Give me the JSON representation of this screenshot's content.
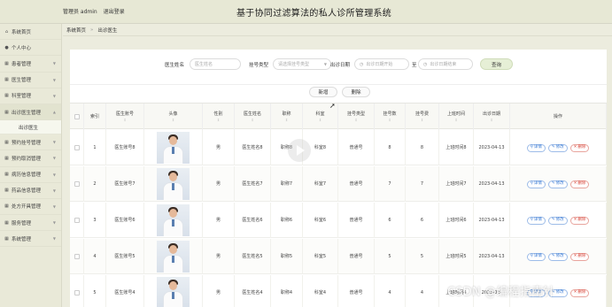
{
  "header": {
    "admin_label": "管理员 admin",
    "logout_label": "退出登录",
    "title": "基于协同过滤算法的私人诊所管理系统"
  },
  "sidebar": {
    "items": [
      {
        "label": "系统首页",
        "icon": "home-icon"
      },
      {
        "label": "个人中心",
        "icon": "user-icon"
      },
      {
        "label": "患者管理",
        "icon": "grid-icon"
      },
      {
        "label": "医生管理",
        "icon": "grid-icon"
      },
      {
        "label": "科室管理",
        "icon": "grid-icon"
      },
      {
        "label": "出诊医生管理",
        "icon": "grid-icon"
      },
      {
        "label": "出诊医生",
        "icon": ""
      },
      {
        "label": "预约挂号管理",
        "icon": "grid-icon"
      },
      {
        "label": "预约取消管理",
        "icon": "grid-icon"
      },
      {
        "label": "病历信息管理",
        "icon": "grid-icon"
      },
      {
        "label": "药品信息管理",
        "icon": "grid-icon"
      },
      {
        "label": "处方开具管理",
        "icon": "grid-icon"
      },
      {
        "label": "服务管理",
        "icon": "grid-icon"
      },
      {
        "label": "系统管理",
        "icon": "grid-icon"
      }
    ]
  },
  "breadcrumb": {
    "home": "系统首页",
    "separator": "»",
    "current": "出诊医生"
  },
  "search": {
    "name_label": "医生姓名",
    "name_placeholder": "医生姓名",
    "type_label": "挂号类型",
    "type_placeholder": "请选择挂号类型",
    "date_label": "出诊日期",
    "date_start_placeholder": "出诊日期开始",
    "to_label": "至",
    "date_end_placeholder": "出诊日期结束",
    "query_button": "查询"
  },
  "actions": {
    "add": "新增",
    "delete": "删除"
  },
  "table": {
    "headers": {
      "index": "索引",
      "doctor_no": "医生账号",
      "avatar": "头像",
      "gender": "性别",
      "doctor_name": "医生姓名",
      "title": "职称",
      "dept": "科室",
      "reg_type": "挂号类型",
      "reg_count": "挂号数",
      "reg_fee": "挂号费",
      "time": "上班时间",
      "date": "出诊日期",
      "ops": "操作"
    },
    "rows": [
      {
        "idx": "1",
        "no": "医生账号8",
        "gender": "男",
        "name": "医生姓名8",
        "title": "职称8",
        "dept": "科室8",
        "type": "普通号",
        "count": "8",
        "fee": "8",
        "time": "上班时间8",
        "date": "2023-04-13"
      },
      {
        "idx": "2",
        "no": "医生账号7",
        "gender": "男",
        "name": "医生姓名7",
        "title": "职称7",
        "dept": "科室7",
        "type": "普通号",
        "count": "7",
        "fee": "7",
        "time": "上班时间7",
        "date": "2023-04-13"
      },
      {
        "idx": "3",
        "no": "医生账号6",
        "gender": "男",
        "name": "医生姓名6",
        "title": "职称6",
        "dept": "科室6",
        "type": "普通号",
        "count": "6",
        "fee": "6",
        "time": "上班时间6",
        "date": "2023-04-13"
      },
      {
        "idx": "4",
        "no": "医生账号5",
        "gender": "男",
        "name": "医生姓名5",
        "title": "职称5",
        "dept": "科室5",
        "type": "普通号",
        "count": "5",
        "fee": "5",
        "time": "上班时间5",
        "date": "2023-04-13"
      },
      {
        "idx": "5",
        "no": "医生账号4",
        "gender": "男",
        "name": "医生姓名4",
        "title": "职称4",
        "dept": "科室4",
        "type": "普通号",
        "count": "4",
        "fee": "4",
        "time": "上班时间4",
        "date": "2023-04-"
      }
    ],
    "op_labels": {
      "detail": "详情",
      "edit": "修改",
      "delete": "删除"
    }
  },
  "watermark": "CSDN @编程指南针",
  "colors": {
    "query_bg": "#e6efd6",
    "detail": "#3a7bd5",
    "delete": "#d9473b"
  }
}
